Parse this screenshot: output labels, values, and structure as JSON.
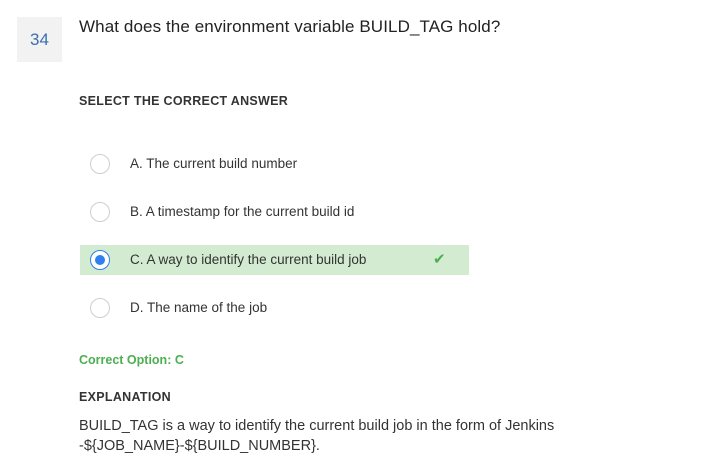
{
  "question": {
    "number": "34",
    "title": "What does the environment variable BUILD_TAG hold?"
  },
  "select_label": "SELECT THE CORRECT ANSWER",
  "options": [
    {
      "label": "A. The current build number",
      "selected": false,
      "correct": false
    },
    {
      "label": "B. A timestamp for the current build id",
      "selected": false,
      "correct": false
    },
    {
      "label": "C. A way to identify the current build job",
      "selected": true,
      "correct": true
    },
    {
      "label": "D. The name of the job",
      "selected": false,
      "correct": false
    }
  ],
  "check_icon": "check-icon",
  "correct_option": "Correct Option: C",
  "explanation": {
    "label": "EXPLANATION",
    "text": "BUILD_TAG is a way to identify the current build job in the form of Jenkins -${JOB_NAME}-${BUILD_NUMBER}."
  },
  "colors": {
    "accent": "#2f80ed",
    "correct_bg": "#d3ebd0",
    "correct_text": "#4caf50",
    "number_text": "#3a6fb0"
  }
}
